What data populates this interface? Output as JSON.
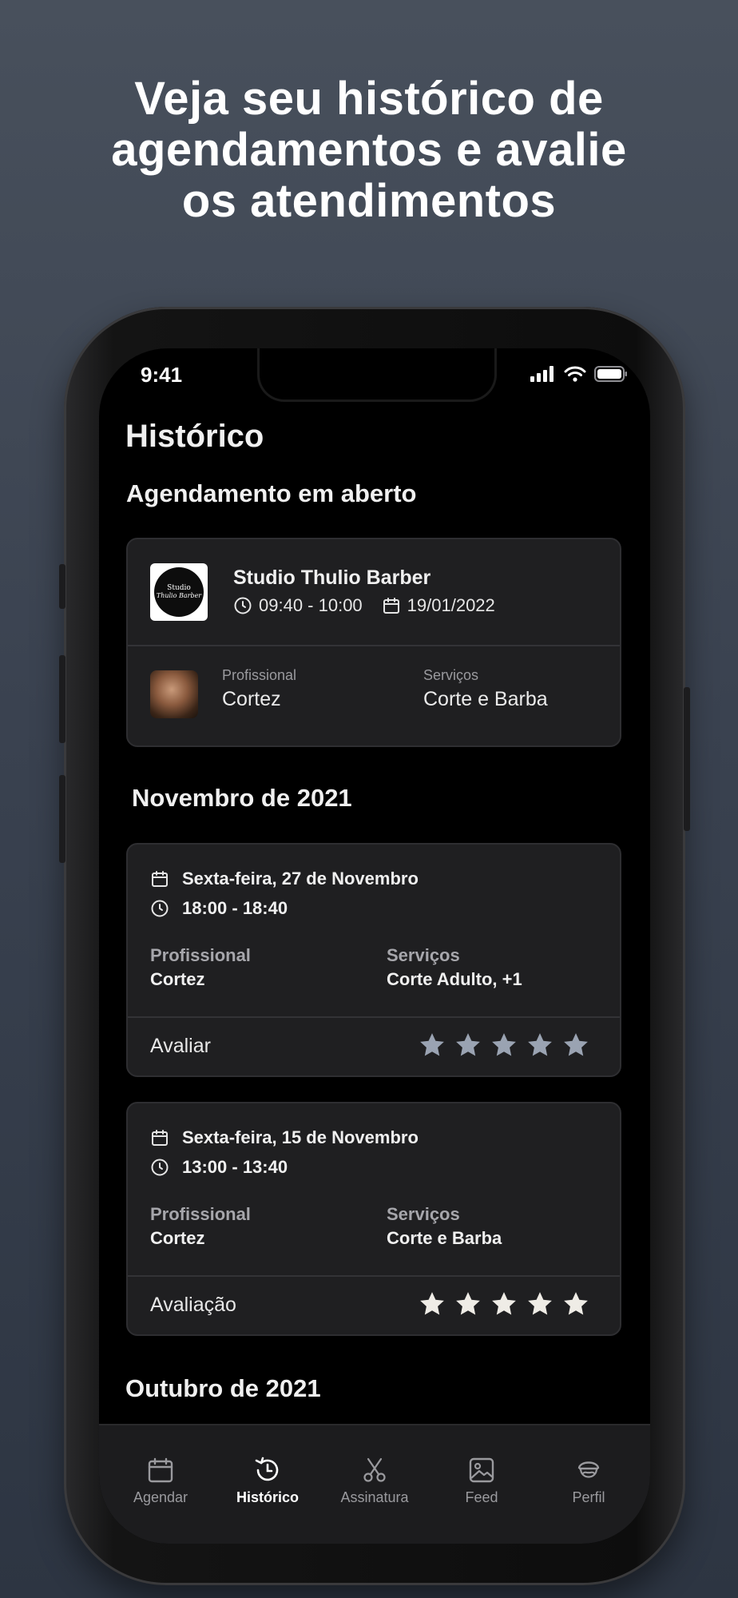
{
  "headline": [
    "Veja seu histórico de",
    "agendamentos e avalie",
    "os atendimentos"
  ],
  "status": {
    "time": "9:41"
  },
  "page_title": "Histórico",
  "open_section": {
    "title": "Agendamento em aberto",
    "logo_text": [
      "Studio",
      "Thulio Barber"
    ],
    "shop": "Studio Thulio Barber",
    "time": "09:40 - 10:00",
    "date": "19/01/2022",
    "professional_label": "Profissional",
    "professional": "Cortez",
    "services_label": "Serviços",
    "services": "Corte e Barba"
  },
  "months": [
    {
      "title": "Novembro de 2021",
      "items": [
        {
          "date": "Sexta-feira, 27 de Novembro",
          "time": "18:00 - 18:40",
          "professional_label": "Profissional",
          "professional": "Cortez",
          "services_label": "Serviços",
          "services": "Corte Adulto, +1",
          "rating_label": "Avaliar",
          "stars_filled": 0
        },
        {
          "date": "Sexta-feira, 15 de Novembro",
          "time": "13:00 - 13:40",
          "professional_label": "Profissional",
          "professional": "Cortez",
          "services_label": "Serviços",
          "services": "Corte e Barba",
          "rating_label": "Avaliação",
          "stars_filled": 5
        }
      ]
    },
    {
      "title": "Outubro de 2021"
    }
  ],
  "tabs": [
    {
      "label": "Agendar",
      "icon": "calendar-icon",
      "active": false
    },
    {
      "label": "Histórico",
      "icon": "history-icon",
      "active": true
    },
    {
      "label": "Assinatura",
      "icon": "scissors-icon",
      "active": false
    },
    {
      "label": "Feed",
      "icon": "image-icon",
      "active": false
    },
    {
      "label": "Perfil",
      "icon": "barber-face-icon",
      "active": false
    }
  ],
  "colors": {
    "star_empty": "#9aa3b2",
    "star_filled": "#efece6",
    "card": "#1f1f21"
  }
}
